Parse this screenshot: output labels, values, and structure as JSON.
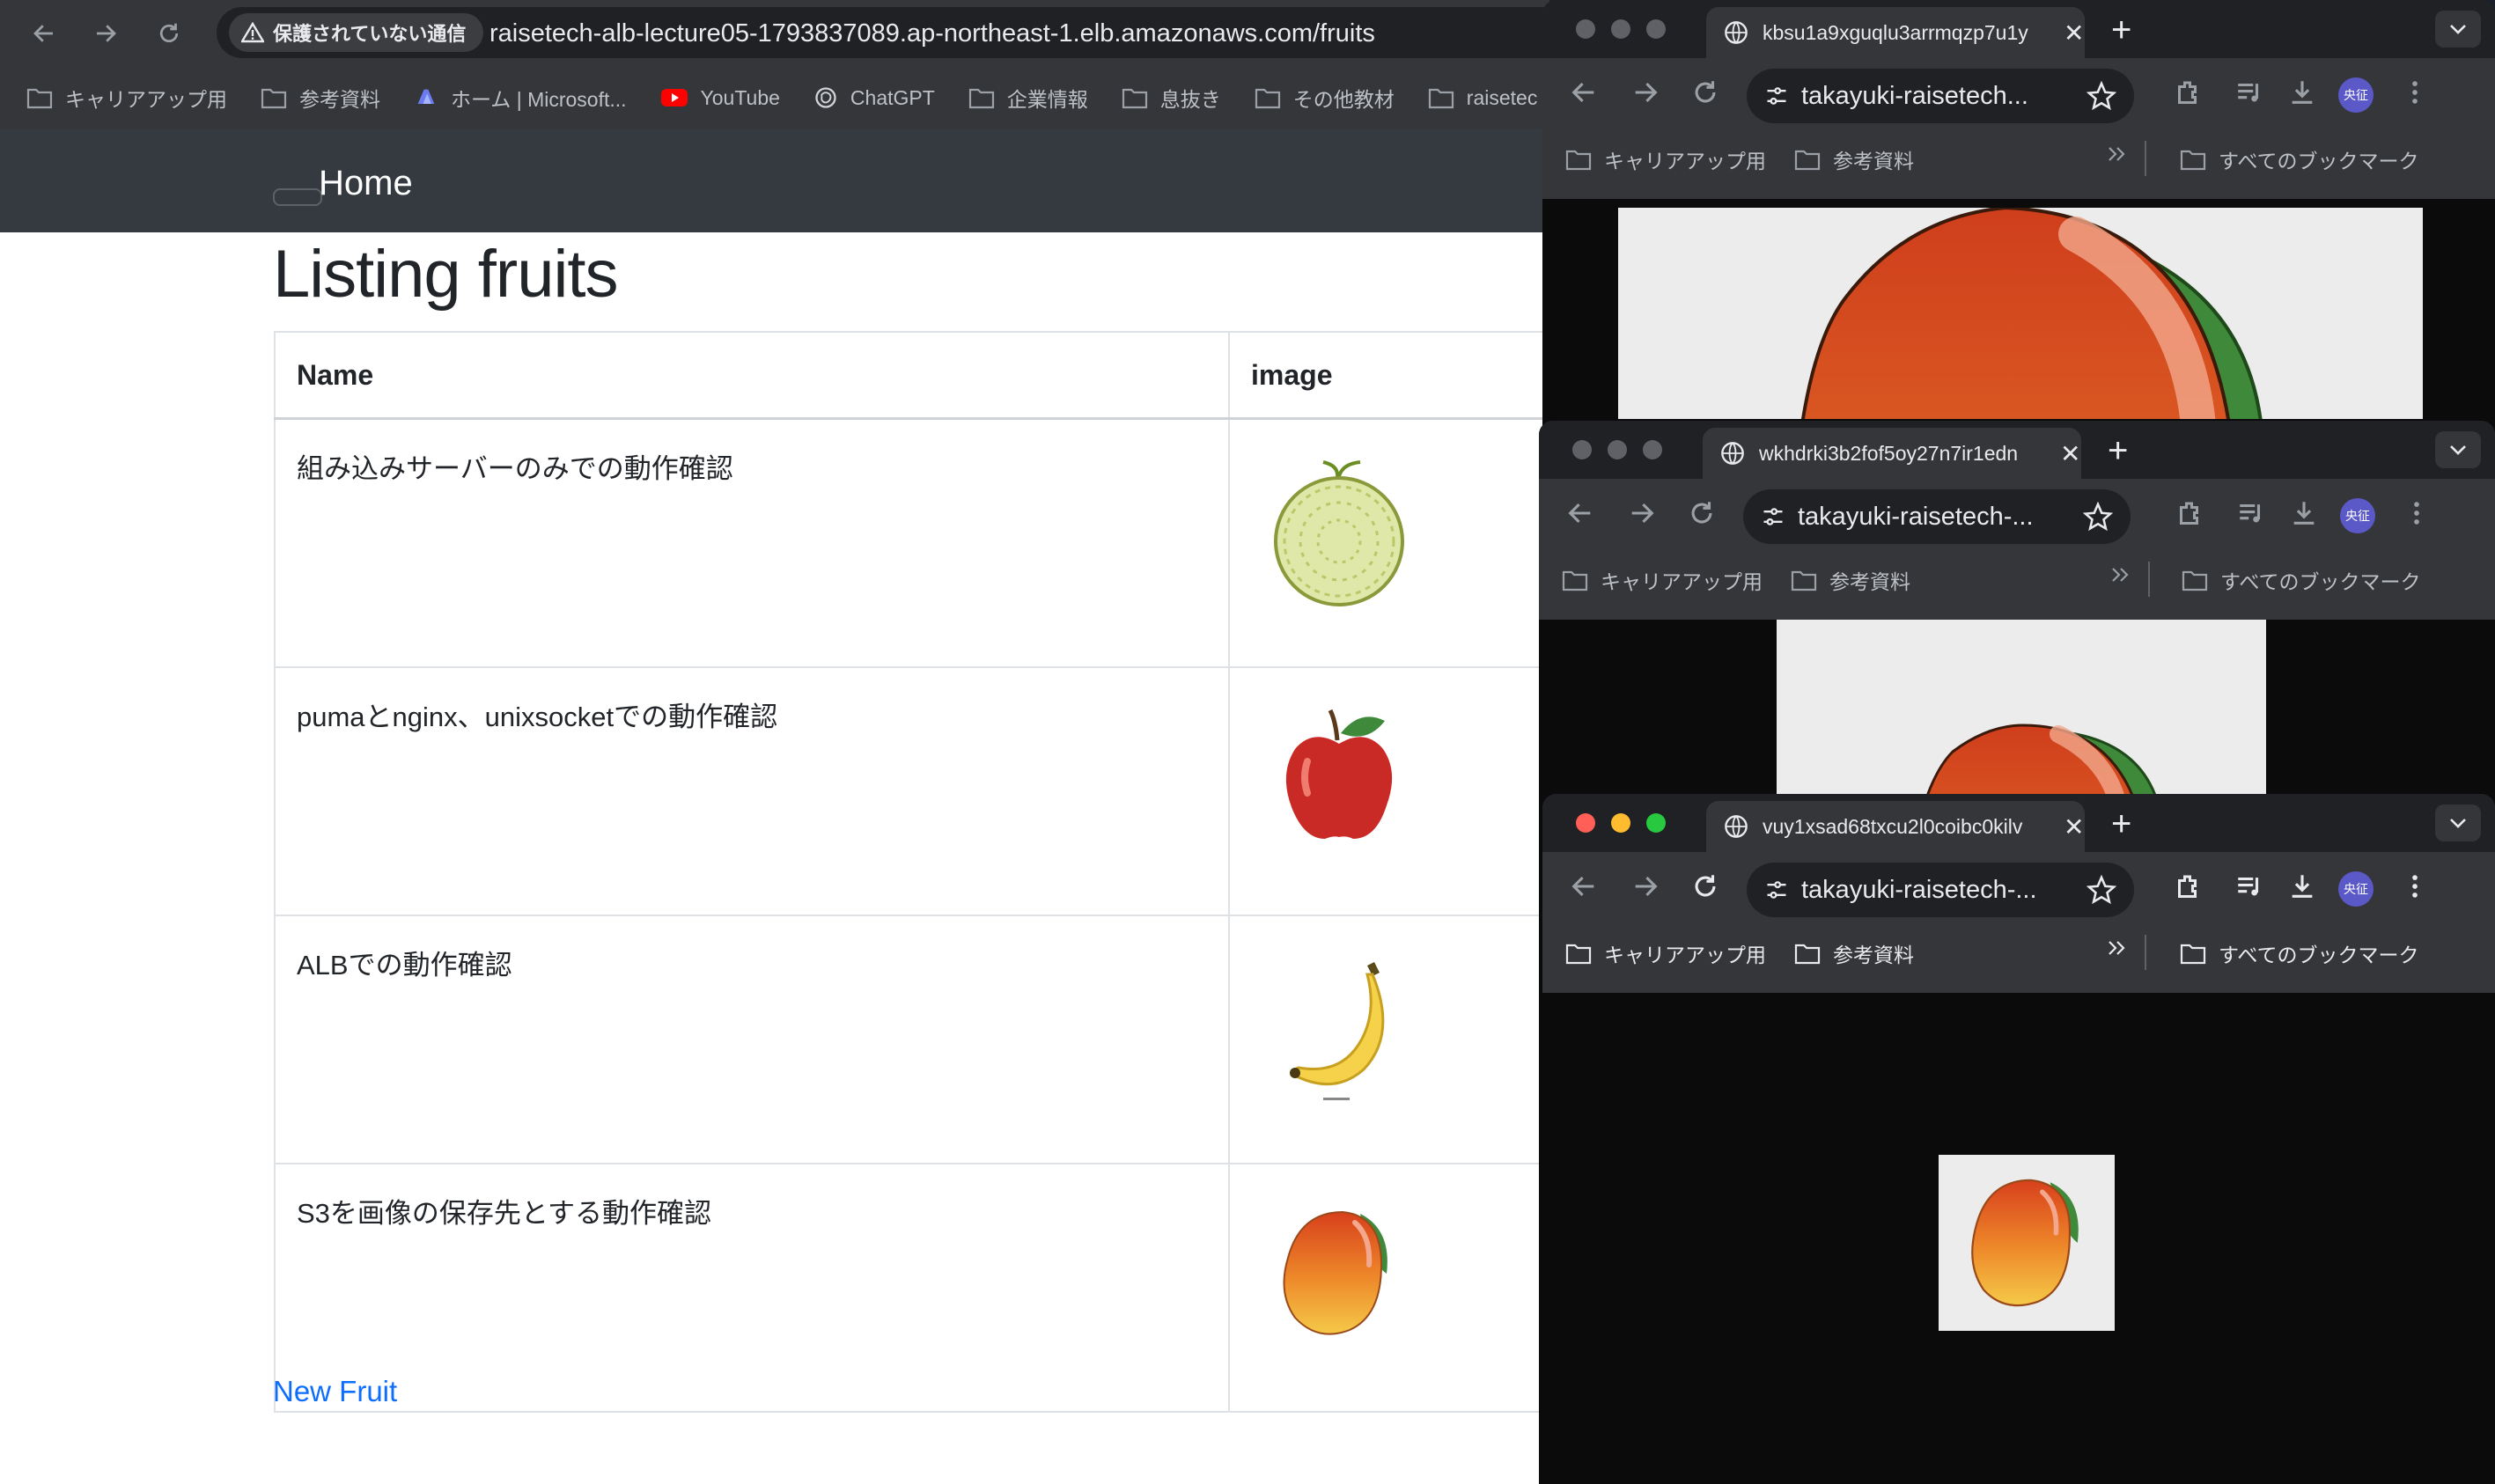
{
  "main_browser": {
    "security_label": "保護されていない通信",
    "url": "raisetech-alb-lecture05-1793837089.ap-northeast-1.elb.amazonaws.com/fruits",
    "bookmarks": [
      {
        "label": "キャリアアップ用",
        "icon": "folder-icon"
      },
      {
        "label": "参考資料",
        "icon": "folder-icon"
      },
      {
        "label": "ホーム | Microsoft...",
        "icon": "copilot-icon"
      },
      {
        "label": "YouTube",
        "icon": "youtube-icon"
      },
      {
        "label": "ChatGPT",
        "icon": "chatgpt-icon"
      },
      {
        "label": "企業情報",
        "icon": "folder-icon"
      },
      {
        "label": "息抜き",
        "icon": "folder-icon"
      },
      {
        "label": "その他教材",
        "icon": "folder-icon"
      },
      {
        "label": "raisetec",
        "icon": "folder-icon"
      }
    ]
  },
  "page": {
    "nav_home": "Home",
    "title": "Listing fruits",
    "table_headers": [
      "Name",
      "image"
    ],
    "rows": [
      {
        "name": "組み込みサーバーのみでの動作確認",
        "image": "melon-image"
      },
      {
        "name": "pumaとnginx、unixsocketでの動作確認",
        "image": "apple-image"
      },
      {
        "name": "ALBでの動作確認",
        "image": "banana-image"
      },
      {
        "name": "S3を画像の保存先とする動作確認",
        "image": "mango-image"
      }
    ],
    "new_link": "New Fruit"
  },
  "windows": [
    {
      "tab_title": "kbsu1a9xguqlu3arrmqzp7u1y",
      "url": "takayuki-raisetech...",
      "image": "mango-image",
      "traffic_lights": "inactive"
    },
    {
      "tab_title": "wkhdrki3b2fof5oy27n7ir1edn",
      "url": "takayuki-raisetech-...",
      "image": "mango-image",
      "traffic_lights": "inactive"
    },
    {
      "tab_title": "vuy1xsad68txcu2l0coibc0kilv",
      "url": "takayuki-raisetech-...",
      "image": "mango-image",
      "traffic_lights": "active"
    }
  ],
  "window_bookmarks": {
    "item1": "キャリアアップ用",
    "item2": "参考資料",
    "all": "すべてのブックマーク"
  },
  "avatar_label": "央征",
  "colors": {
    "link": "#0d6efd",
    "navbar": "#343a40",
    "chrome": "#35363a",
    "close": "#ff5f57",
    "minimize": "#febc2e",
    "zoom": "#28c840"
  }
}
